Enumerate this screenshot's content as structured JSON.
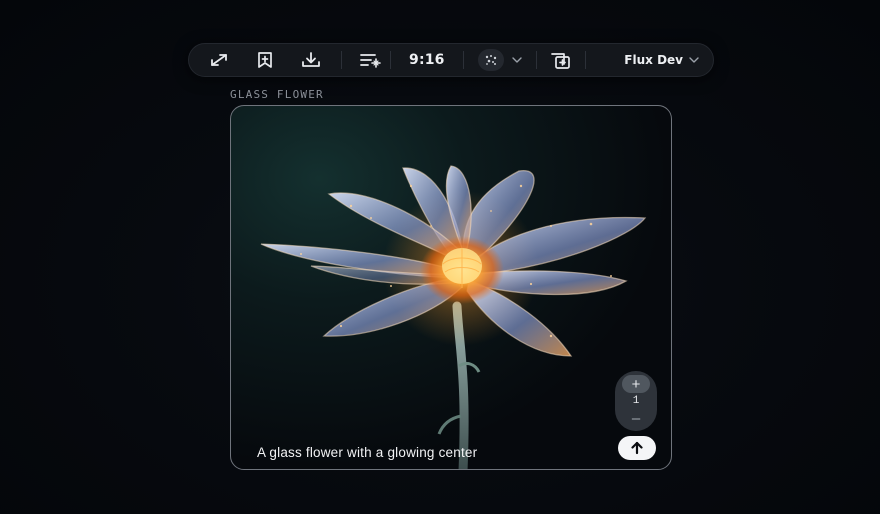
{
  "toolbar": {
    "icons": [
      "expand-icon",
      "bookmark-add-icon",
      "download-icon",
      "prompt-enhance-icon",
      "style-icon",
      "add-layer-icon"
    ],
    "aspect_ratio": "9:16",
    "model": "Flux Dev"
  },
  "card": {
    "title": "GLASS FLOWER",
    "prompt": "A glass flower with a glowing center",
    "image_count": "1",
    "increment_symbol": "+",
    "decrement_symbol": "–"
  },
  "colors": {
    "background": "#05070b",
    "toolbar_bg": "#14171c",
    "accent_glow": "#ffa531",
    "submit_bg": "#f4f5f7"
  }
}
